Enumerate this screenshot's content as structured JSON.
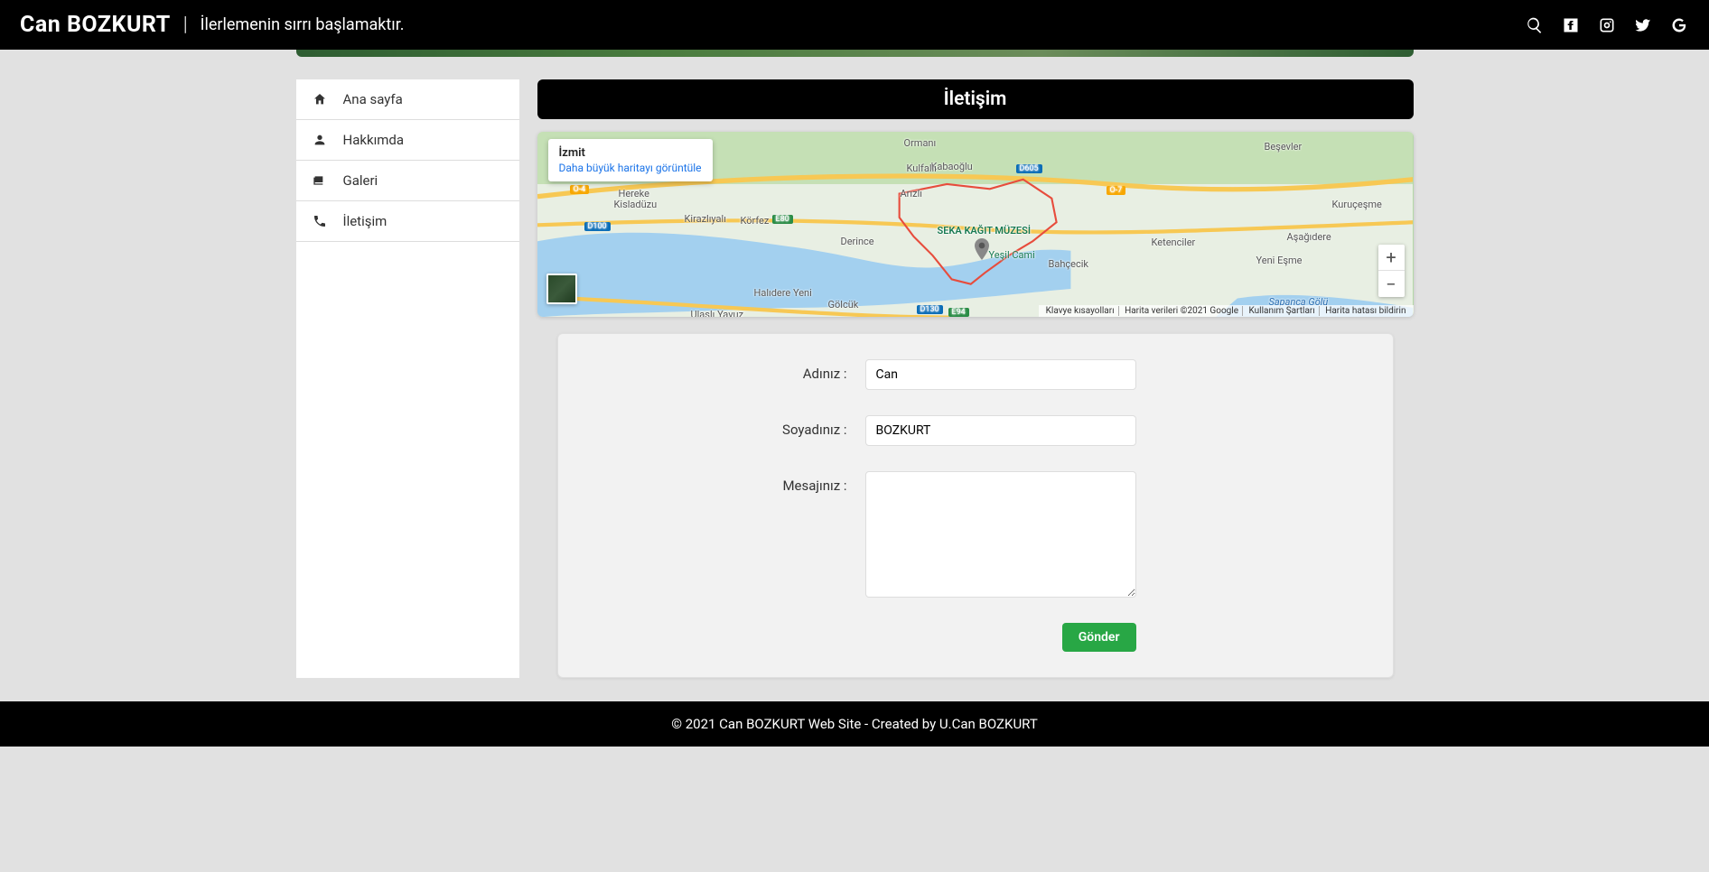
{
  "header": {
    "brand": "Can BOZKURT",
    "tagline": "İlerlemenin sırrı başlamaktır."
  },
  "sidebar": {
    "items": [
      {
        "label": "Ana sayfa",
        "icon": "home"
      },
      {
        "label": "Hakkımda",
        "icon": "user"
      },
      {
        "label": "Galeri",
        "icon": "images"
      },
      {
        "label": "İletişim",
        "icon": "phone"
      }
    ]
  },
  "page": {
    "title": "İletişim"
  },
  "map": {
    "infobox_title": "İzmit",
    "infobox_link": "Daha büyük haritayı görüntüle",
    "attribution": {
      "keyboard": "Klavye kısayolları",
      "data": "Harita verileri ©2021 Google",
      "terms": "Kullanım Şartları",
      "report": "Harita hatası bildirin"
    },
    "poi_label": "SEKA KAĞIT MÜZESİ",
    "places": {
      "ormani": "Ormanı",
      "kabaoglu": "Kabaoğlu",
      "kislaguzu": "Kisladüzu",
      "hereke": "Hereke",
      "kiraz": "Kirazlıyalı",
      "korfez": "Körfez",
      "arizli": "Arızlı",
      "kulfalli": "Kulfallı",
      "derince": "Derince",
      "golcuk": "Gölcük",
      "halidere": "Halıdere Yeni",
      "ulasli": "Ulaşlı Yavuz",
      "kuruces": "Kuruçeşme",
      "besevler": "Beşevler",
      "yesilcami": "Yeşil Cami",
      "bahcecik": "Bahçecik",
      "yenisme": "Yeni Eşme",
      "ketenciler": "Ketenciler",
      "asagidere": "Aşağıdere",
      "sapanca": "Sapanca Gölü"
    },
    "roads": {
      "o4": "O-4",
      "o7": "O-7",
      "d100": "D100",
      "d130": "D130",
      "d605": "D605",
      "e80": "E80",
      "e94": "E94"
    }
  },
  "form": {
    "name_label": "Adınız :",
    "name_value": "Can",
    "surname_label": "Soyadınız :",
    "surname_value": "BOZKURT",
    "message_label": "Mesajınız :",
    "message_value": "",
    "submit": "Gönder"
  },
  "footer": {
    "text": "© 2021 Can BOZKURT Web Site - Created by U.Can BOZKURT"
  }
}
